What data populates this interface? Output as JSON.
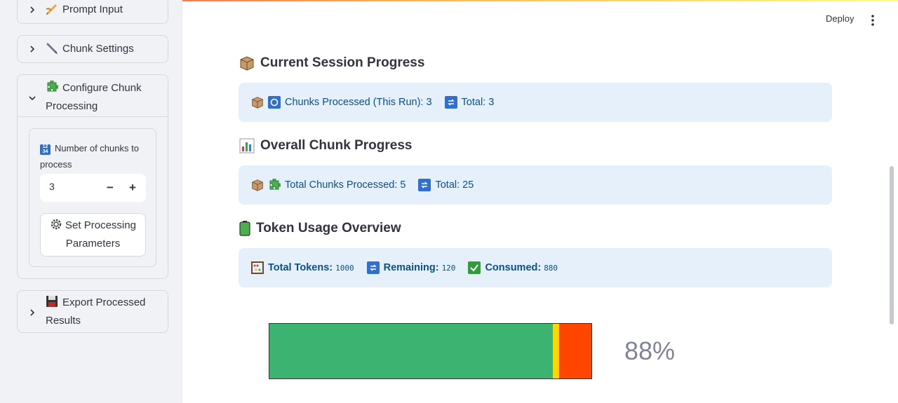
{
  "header": {
    "deploy_label": "Deploy",
    "menu_icon": "kebab-menu-icon"
  },
  "sidebar": {
    "expanders": [
      {
        "label": "Prompt Input",
        "icon": "writing-hand-icon",
        "expanded": false
      },
      {
        "label": "Chunk Settings",
        "icon": "pen-icon",
        "expanded": false
      },
      {
        "label": "Configure Chunk Processing",
        "icon": "puzzle-icon",
        "expanded": true
      },
      {
        "label": "Export Processed Results",
        "icon": "floppy-disk-icon",
        "expanded": false
      }
    ],
    "configure": {
      "number_label": "Number of chunks to process",
      "number_value": "3",
      "minus": "−",
      "plus": "+",
      "button_label": "Set Processing Parameters"
    }
  },
  "main": {
    "session": {
      "title": "Current Session Progress",
      "processed_label": "Chunks Processed (This Run): 3",
      "total_label": "Total: 3"
    },
    "overall": {
      "title": "Overall Chunk Progress",
      "processed_label": "Total Chunks Processed: 5",
      "total_label": "Total: 25"
    },
    "tokens": {
      "title": "Token Usage Overview",
      "total_label": "Total Tokens:",
      "total_value": "1000",
      "remaining_label": "Remaining:",
      "remaining_value": "120",
      "consumed_label": "Consumed:",
      "consumed_value": "880"
    },
    "usage_bar": {
      "percent_label": "88%",
      "segments": [
        {
          "fraction": 0.88,
          "color": "#3cb371"
        },
        {
          "fraction": 0.02,
          "color": "#ffd700"
        },
        {
          "fraction": 0.1,
          "color": "#ff4500"
        }
      ]
    }
  }
}
